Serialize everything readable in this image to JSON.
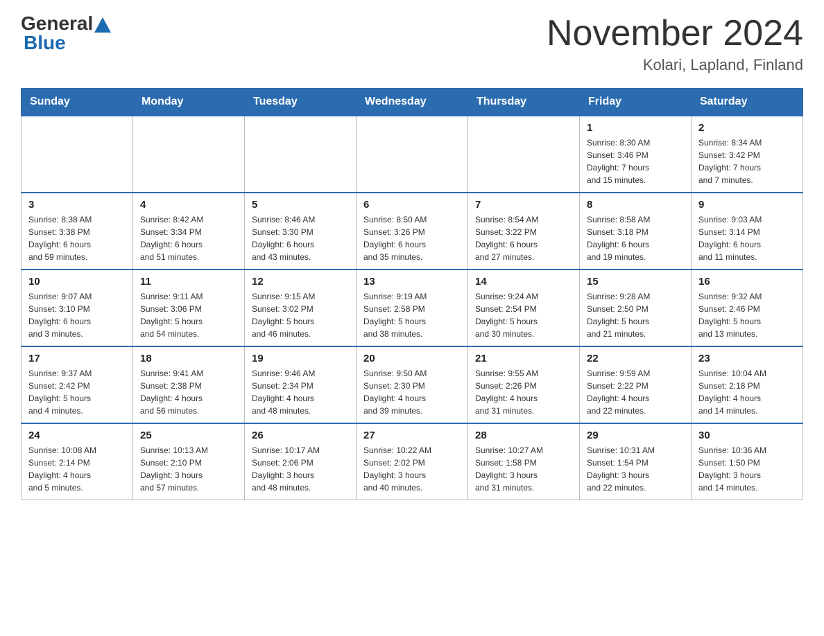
{
  "header": {
    "logo": {
      "general": "General",
      "blue": "Blue"
    },
    "title": "November 2024",
    "location": "Kolari, Lapland, Finland"
  },
  "days_of_week": [
    "Sunday",
    "Monday",
    "Tuesday",
    "Wednesday",
    "Thursday",
    "Friday",
    "Saturday"
  ],
  "weeks": [
    [
      {
        "day": "",
        "info": ""
      },
      {
        "day": "",
        "info": ""
      },
      {
        "day": "",
        "info": ""
      },
      {
        "day": "",
        "info": ""
      },
      {
        "day": "",
        "info": ""
      },
      {
        "day": "1",
        "info": "Sunrise: 8:30 AM\nSunset: 3:46 PM\nDaylight: 7 hours\nand 15 minutes."
      },
      {
        "day": "2",
        "info": "Sunrise: 8:34 AM\nSunset: 3:42 PM\nDaylight: 7 hours\nand 7 minutes."
      }
    ],
    [
      {
        "day": "3",
        "info": "Sunrise: 8:38 AM\nSunset: 3:38 PM\nDaylight: 6 hours\nand 59 minutes."
      },
      {
        "day": "4",
        "info": "Sunrise: 8:42 AM\nSunset: 3:34 PM\nDaylight: 6 hours\nand 51 minutes."
      },
      {
        "day": "5",
        "info": "Sunrise: 8:46 AM\nSunset: 3:30 PM\nDaylight: 6 hours\nand 43 minutes."
      },
      {
        "day": "6",
        "info": "Sunrise: 8:50 AM\nSunset: 3:26 PM\nDaylight: 6 hours\nand 35 minutes."
      },
      {
        "day": "7",
        "info": "Sunrise: 8:54 AM\nSunset: 3:22 PM\nDaylight: 6 hours\nand 27 minutes."
      },
      {
        "day": "8",
        "info": "Sunrise: 8:58 AM\nSunset: 3:18 PM\nDaylight: 6 hours\nand 19 minutes."
      },
      {
        "day": "9",
        "info": "Sunrise: 9:03 AM\nSunset: 3:14 PM\nDaylight: 6 hours\nand 11 minutes."
      }
    ],
    [
      {
        "day": "10",
        "info": "Sunrise: 9:07 AM\nSunset: 3:10 PM\nDaylight: 6 hours\nand 3 minutes."
      },
      {
        "day": "11",
        "info": "Sunrise: 9:11 AM\nSunset: 3:06 PM\nDaylight: 5 hours\nand 54 minutes."
      },
      {
        "day": "12",
        "info": "Sunrise: 9:15 AM\nSunset: 3:02 PM\nDaylight: 5 hours\nand 46 minutes."
      },
      {
        "day": "13",
        "info": "Sunrise: 9:19 AM\nSunset: 2:58 PM\nDaylight: 5 hours\nand 38 minutes."
      },
      {
        "day": "14",
        "info": "Sunrise: 9:24 AM\nSunset: 2:54 PM\nDaylight: 5 hours\nand 30 minutes."
      },
      {
        "day": "15",
        "info": "Sunrise: 9:28 AM\nSunset: 2:50 PM\nDaylight: 5 hours\nand 21 minutes."
      },
      {
        "day": "16",
        "info": "Sunrise: 9:32 AM\nSunset: 2:46 PM\nDaylight: 5 hours\nand 13 minutes."
      }
    ],
    [
      {
        "day": "17",
        "info": "Sunrise: 9:37 AM\nSunset: 2:42 PM\nDaylight: 5 hours\nand 4 minutes."
      },
      {
        "day": "18",
        "info": "Sunrise: 9:41 AM\nSunset: 2:38 PM\nDaylight: 4 hours\nand 56 minutes."
      },
      {
        "day": "19",
        "info": "Sunrise: 9:46 AM\nSunset: 2:34 PM\nDaylight: 4 hours\nand 48 minutes."
      },
      {
        "day": "20",
        "info": "Sunrise: 9:50 AM\nSunset: 2:30 PM\nDaylight: 4 hours\nand 39 minutes."
      },
      {
        "day": "21",
        "info": "Sunrise: 9:55 AM\nSunset: 2:26 PM\nDaylight: 4 hours\nand 31 minutes."
      },
      {
        "day": "22",
        "info": "Sunrise: 9:59 AM\nSunset: 2:22 PM\nDaylight: 4 hours\nand 22 minutes."
      },
      {
        "day": "23",
        "info": "Sunrise: 10:04 AM\nSunset: 2:18 PM\nDaylight: 4 hours\nand 14 minutes."
      }
    ],
    [
      {
        "day": "24",
        "info": "Sunrise: 10:08 AM\nSunset: 2:14 PM\nDaylight: 4 hours\nand 5 minutes."
      },
      {
        "day": "25",
        "info": "Sunrise: 10:13 AM\nSunset: 2:10 PM\nDaylight: 3 hours\nand 57 minutes."
      },
      {
        "day": "26",
        "info": "Sunrise: 10:17 AM\nSunset: 2:06 PM\nDaylight: 3 hours\nand 48 minutes."
      },
      {
        "day": "27",
        "info": "Sunrise: 10:22 AM\nSunset: 2:02 PM\nDaylight: 3 hours\nand 40 minutes."
      },
      {
        "day": "28",
        "info": "Sunrise: 10:27 AM\nSunset: 1:58 PM\nDaylight: 3 hours\nand 31 minutes."
      },
      {
        "day": "29",
        "info": "Sunrise: 10:31 AM\nSunset: 1:54 PM\nDaylight: 3 hours\nand 22 minutes."
      },
      {
        "day": "30",
        "info": "Sunrise: 10:36 AM\nSunset: 1:50 PM\nDaylight: 3 hours\nand 14 minutes."
      }
    ]
  ]
}
